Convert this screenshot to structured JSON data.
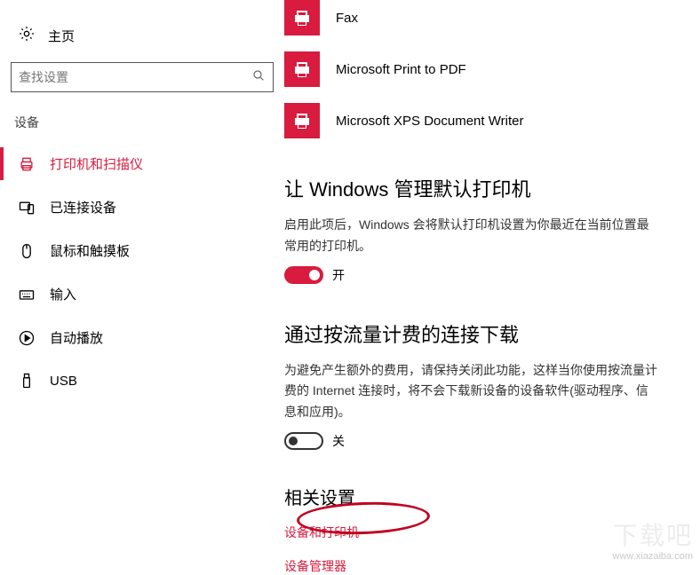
{
  "sidebar": {
    "home_label": "主页",
    "search_placeholder": "查找设置",
    "section_label": "设备",
    "items": [
      {
        "label": "打印机和扫描仪"
      },
      {
        "label": "已连接设备"
      },
      {
        "label": "鼠标和触摸板"
      },
      {
        "label": "输入"
      },
      {
        "label": "自动播放"
      },
      {
        "label": "USB"
      }
    ]
  },
  "printers": [
    {
      "label": "Fax"
    },
    {
      "label": "Microsoft Print to PDF"
    },
    {
      "label": "Microsoft XPS Document Writer"
    }
  ],
  "section_default": {
    "title": "让 Windows 管理默认打印机",
    "desc": "启用此项后，Windows 会将默认打印机设置为你最近在当前位置最常用的打印机。",
    "toggle_state": "开"
  },
  "section_metered": {
    "title": "通过按流量计费的连接下载",
    "desc": "为避免产生额外的费用，请保持关闭此功能，这样当你使用按流量计费的 Internet 连接时，将不会下载新设备的设备软件(驱动程序、信息和应用)。",
    "toggle_state": "关"
  },
  "related": {
    "title": "相关设置",
    "links": [
      "设备和打印机",
      "设备管理器"
    ]
  },
  "watermark": {
    "brand": "下载吧",
    "url": "www.xiazaiba.com"
  }
}
